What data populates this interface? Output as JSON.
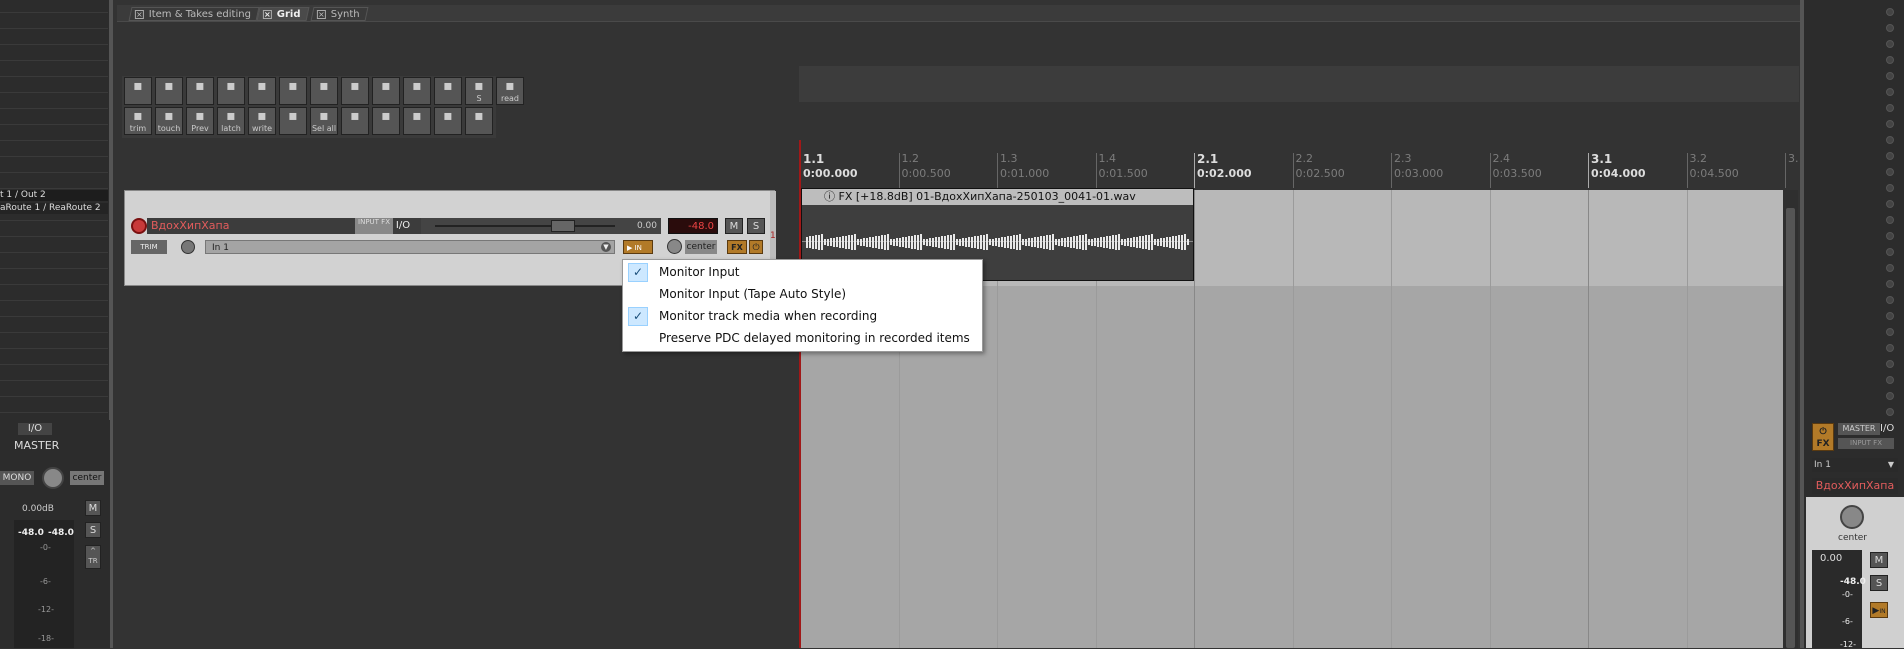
{
  "tabs": [
    {
      "label": "Item & Takes editing",
      "active": false
    },
    {
      "label": "Grid",
      "active": true
    },
    {
      "label": "Synth",
      "active": false
    }
  ],
  "left_mixer": {
    "route1": "t 1 / Out 2",
    "route2": "aRoute 1 / ReaRoute 2"
  },
  "toolbar": {
    "row1": [
      {
        "icon": "metronome-icon",
        "label": ""
      },
      {
        "icon": "select-icon",
        "label": ""
      },
      {
        "icon": "item-icon",
        "label": ""
      },
      {
        "icon": "envelope-icon",
        "label": ""
      },
      {
        "icon": "draw-icon",
        "label": ""
      },
      {
        "icon": "hand-icon",
        "label": ""
      },
      {
        "icon": "automation-icon",
        "label": ""
      },
      {
        "icon": "grid-icon",
        "label": ""
      },
      {
        "icon": "loop-icon",
        "label": ""
      },
      {
        "icon": "lock-icon",
        "label": ""
      },
      {
        "icon": "ripple-icon",
        "label": ""
      },
      {
        "icon": "solo-icon",
        "label": "S"
      },
      {
        "icon": "read-icon",
        "label": "read"
      }
    ],
    "row2": [
      {
        "icon": "trim-icon",
        "label": "trim"
      },
      {
        "icon": "touch-icon",
        "label": "touch"
      },
      {
        "icon": "preview-icon",
        "label": "Prev"
      },
      {
        "icon": "latch-icon",
        "label": "latch"
      },
      {
        "icon": "write-icon",
        "label": "write"
      },
      {
        "icon": "record-icon",
        "label": ""
      },
      {
        "icon": "select-all-icon",
        "label": "Sel all tracks"
      },
      {
        "icon": "pencil-icon",
        "label": ""
      },
      {
        "icon": "media-icon",
        "label": ""
      },
      {
        "icon": "chart-icon",
        "label": ""
      },
      {
        "icon": "freeze-off-icon",
        "label": ""
      },
      {
        "icon": "freeze-icon",
        "label": ""
      }
    ]
  },
  "ruler": {
    "bars": [
      {
        "bar": "1.1",
        "time": "0:00.000",
        "major": true
      },
      {
        "bar": "1.2",
        "time": "0:00.500",
        "major": false
      },
      {
        "bar": "1.3",
        "time": "0:01.000",
        "major": false
      },
      {
        "bar": "1.4",
        "time": "0:01.500",
        "major": false
      },
      {
        "bar": "2.1",
        "time": "0:02.000",
        "major": true
      },
      {
        "bar": "2.2",
        "time": "0:02.500",
        "major": false
      },
      {
        "bar": "2.3",
        "time": "0:03.000",
        "major": false
      },
      {
        "bar": "2.4",
        "time": "0:03.500",
        "major": false
      },
      {
        "bar": "3.1",
        "time": "0:04.000",
        "major": true
      },
      {
        "bar": "3.2",
        "time": "0:04.500",
        "major": false
      },
      {
        "bar": "3.",
        "time": "",
        "major": false
      }
    ]
  },
  "track": {
    "name": "ВдохХипХапа",
    "input_fx": "INPUT FX",
    "io": "I/O",
    "volume": "0.00",
    "peak": "-48.0",
    "mute": "M",
    "solo": "S",
    "trim": "TRIM",
    "input": "In 1",
    "monitor": "IN",
    "pan": "center",
    "fx": "FX",
    "power": "⏻",
    "track_number": "1"
  },
  "item": {
    "header": "ⓘ  FX  [+18.8dB] 01-ВдохХипХапа-250103_0041-01.wav"
  },
  "context_menu": {
    "items": [
      {
        "label": "Monitor Input",
        "checked": true
      },
      {
        "label": "Monitor Input (Tape Auto Style)",
        "checked": false
      },
      {
        "label": "Monitor track media when recording",
        "checked": true
      },
      {
        "label": "Preserve PDC delayed monitoring in recorded items",
        "checked": false
      }
    ]
  },
  "master_left": {
    "io": "I/O",
    "label": "MASTER",
    "mono": "MONO",
    "pan": "center",
    "db": "0.00dB",
    "peak_l": "-48.0",
    "peak_r": "-48.0",
    "scale": [
      "-0-",
      "-6-",
      "-12-",
      "-18-"
    ],
    "mute": "M",
    "solo": "S",
    "trim": "TR"
  },
  "mixer_right": {
    "fx": "FX",
    "master_btn": "MASTER",
    "io": "I/O",
    "input_fx": "INPUT FX",
    "input": "In 1",
    "name": "ВдохХипХапа",
    "pan": "center",
    "db": "0.00",
    "peak": "-48.0",
    "scale": [
      "-0-",
      "-6-",
      "-12-"
    ],
    "mute": "M",
    "solo": "S",
    "monitor": "IN"
  },
  "colors": {
    "accent_orange": "#b27a28",
    "track_name_red": "#e25c5c",
    "menu_check_bg": "#cde8ff"
  }
}
